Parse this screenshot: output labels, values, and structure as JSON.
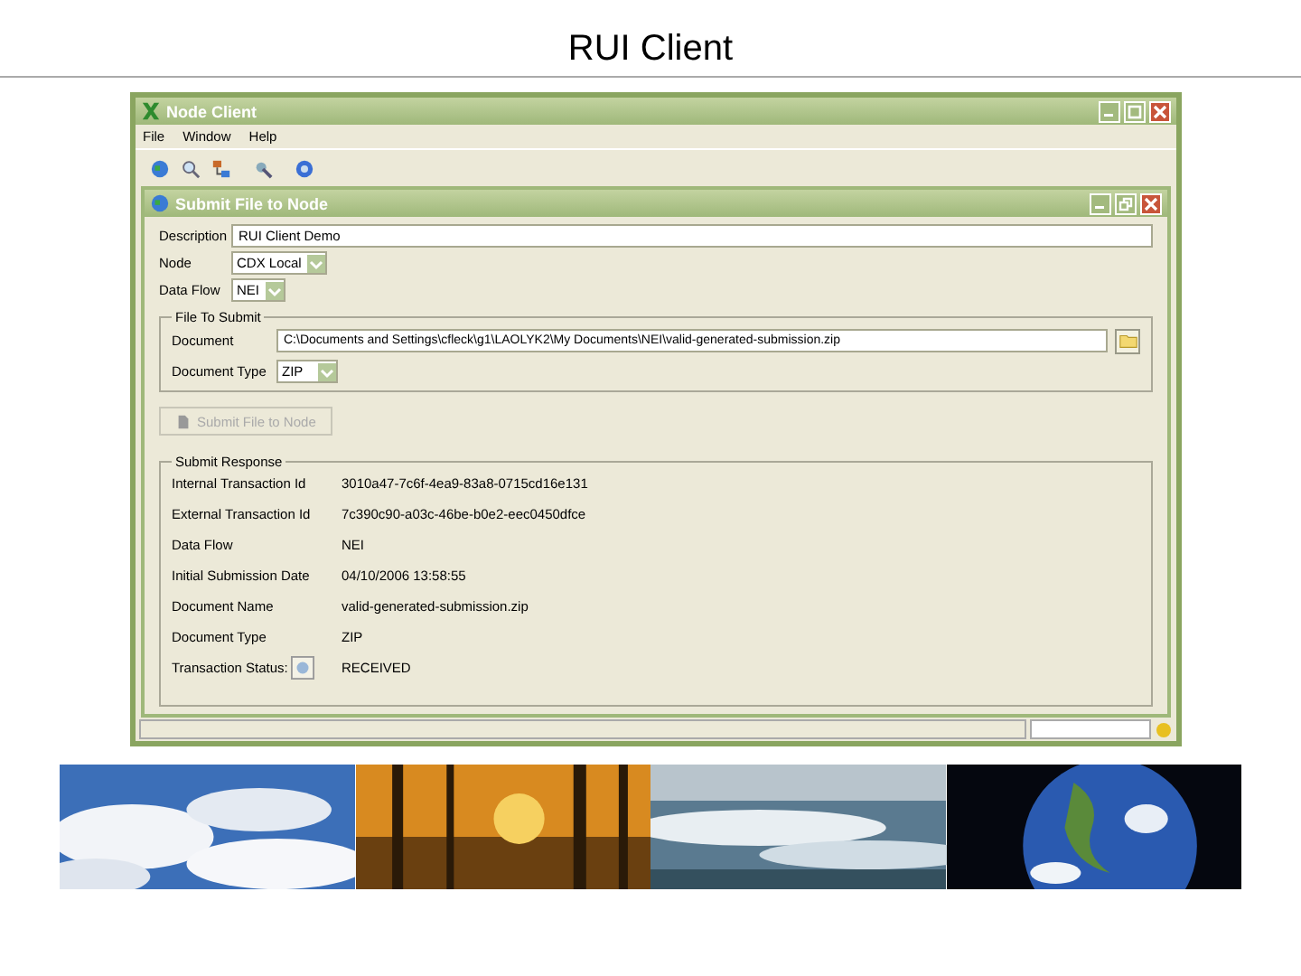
{
  "slide_title": "RUI Client",
  "window": {
    "title": "Node Client"
  },
  "menu": [
    "File",
    "Window",
    "Help"
  ],
  "inner_window": {
    "title": "Submit File to Node"
  },
  "form": [
    {
      "label": "Description",
      "value": "RUI Client Demo",
      "kind": "text"
    },
    {
      "label": "Node",
      "value": "CDX Local",
      "kind": "combo"
    },
    {
      "label": "Data Flow",
      "value": "NEI",
      "kind": "combo"
    }
  ],
  "file_section": {
    "legend": "File To Submit",
    "document": {
      "label": "Document",
      "value": "C:\\Documents and Settings\\cfleck\\g1\\LAOLYK2\\My Documents\\NEI\\valid-generated-submission.zip"
    },
    "document_type": {
      "label": "Document Type",
      "value": "ZIP"
    },
    "submit_button": {
      "label": "Submit File to Node",
      "disabled": true
    }
  },
  "response": {
    "legend": "Submit Response",
    "rows": [
      {
        "label": "Internal Transaction Id",
        "value": "3010a47-7c6f-4ea9-83a8-0715cd16e131",
        "kind": "text"
      },
      {
        "label": "External Transaction Id",
        "value": "7c390c90-a03c-46be-b0e2-eec0450dfce",
        "kind": "text"
      },
      {
        "label": "Data Flow",
        "value": "NEI",
        "kind": "text"
      },
      {
        "label": "Initial Submission Date",
        "value": "04/10/2006 13:58:55",
        "kind": "text"
      },
      {
        "label": "Document Name",
        "value": "valid-generated-submission.zip",
        "kind": "text"
      },
      {
        "label": "Document Type",
        "value": "ZIP",
        "kind": "text"
      },
      {
        "label": "Transaction Status:",
        "value": "RECEIVED",
        "kind": "status"
      }
    ]
  }
}
